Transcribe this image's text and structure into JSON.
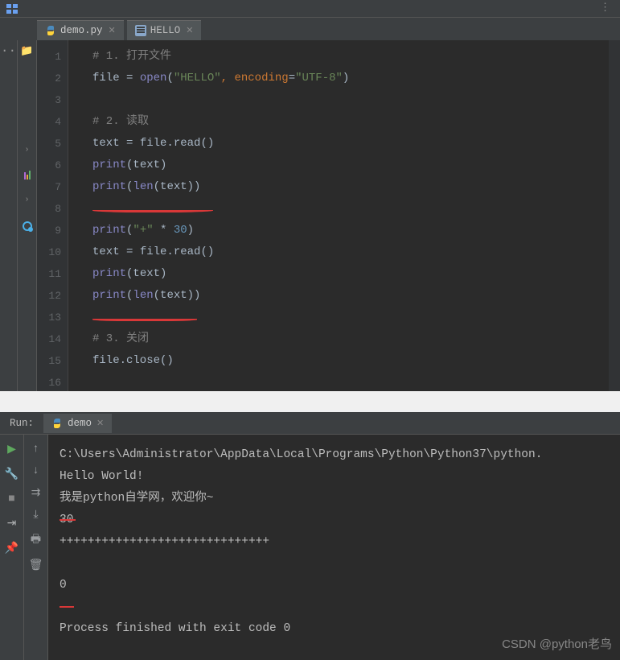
{
  "tabs": [
    {
      "label": "demo.py",
      "icon": "python-icon",
      "active": true
    },
    {
      "label": "HELLO",
      "icon": "text-file-icon",
      "active": false
    }
  ],
  "gutter": [
    "1",
    "2",
    "3",
    "4",
    "5",
    "6",
    "7",
    "8",
    "9",
    "10",
    "11",
    "12",
    "13",
    "14",
    "15",
    "16"
  ],
  "code": {
    "l1": {
      "c": "# 1. 打开文件"
    },
    "l2": {
      "a": "file ",
      "op": "= ",
      "fn": "open",
      "p1": "(",
      "s1": "\"HELLO\"",
      "comma": ", ",
      "kw": "encoding",
      "eq": "=",
      "s2": "\"UTF-8\"",
      "p2": ")"
    },
    "l4": {
      "c": "# 2. 读取"
    },
    "l5": {
      "a": "text ",
      "op": "= ",
      "b": "file.read()"
    },
    "l6": {
      "fn": "print",
      "p": "(text)"
    },
    "l7": {
      "fn": "print",
      "p1": "(",
      "fn2": "len",
      "p2": "(text))"
    },
    "l9": {
      "fn": "print",
      "p1": "(",
      "s": "\"+\"",
      "sp": " ",
      "op": "* ",
      "n": "30",
      "p2": ")"
    },
    "l10": {
      "a": "text ",
      "op": "= ",
      "b": "file.read()"
    },
    "l11": {
      "fn": "print",
      "p": "(text)"
    },
    "l12": {
      "fn": "print",
      "p1": "(",
      "fn2": "len",
      "p2": "(text))"
    },
    "l14": {
      "c": "# 3. 关闭"
    },
    "l15": {
      "a": "file.close()"
    }
  },
  "run": {
    "label": "Run:",
    "tab_label": "demo",
    "lines": {
      "path": "C:\\Users\\Administrator\\AppData\\Local\\Programs\\Python\\Python37\\python.",
      "hello": "Hello World!",
      "cn": "我是python自学网，欢迎你~",
      "len1": "30",
      "plus": "++++++++++++++++++++++++++++++",
      "len2": "0",
      "exit": "Process finished with exit code 0"
    }
  },
  "watermark": "CSDN @python老鸟"
}
